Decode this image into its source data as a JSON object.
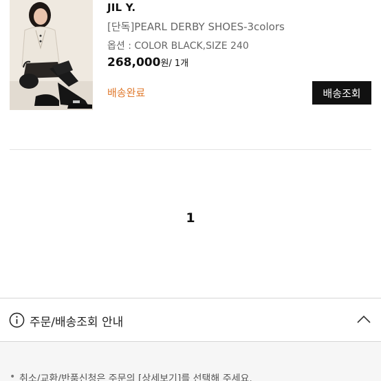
{
  "order": {
    "brand": "JIL Y.",
    "product_name": "[단독]PEARL DERBY SHOES-3colors",
    "option": "옵션 : COLOR BLACK,SIZE 240",
    "price": "268,000",
    "price_unit": "원",
    "quantity": "/ 1개",
    "status": "배송완료",
    "status_color": "#e07a2e",
    "track_button_label": "배송조회"
  },
  "pagination": {
    "current_page": "1"
  },
  "guide": {
    "title": "주문/배송조회 안내",
    "icon": "info-icon",
    "toggle_icon": "chevron-up-icon",
    "notice": "취소/교환/반품신청은 주문의 [상세보기]를 선택해 주세요."
  }
}
